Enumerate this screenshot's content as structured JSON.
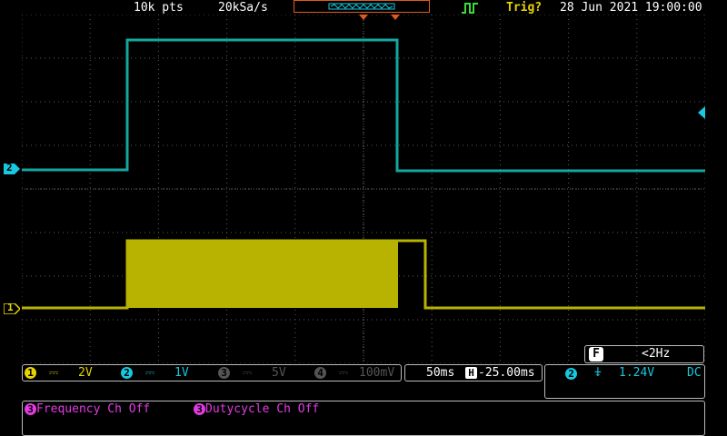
{
  "header": {
    "record_length": "10k pts",
    "sample_rate": "20kSa/s",
    "trigger_status": "Trig?",
    "datetime": "28 Jun 2021 19:00:00"
  },
  "channel_markers": {
    "ch1": "1",
    "ch2": "2"
  },
  "channels": [
    {
      "num": "1",
      "coupling_icon": "dc-coupling-icon",
      "scale": "2V",
      "color": "#e8d400"
    },
    {
      "num": "2",
      "coupling_icon": "dc-coupling-icon",
      "scale": "1V",
      "color": "#16c9e0"
    },
    {
      "num": "3",
      "coupling_icon": "dc-coupling-icon",
      "scale": "5V",
      "color": "#555555"
    },
    {
      "num": "4",
      "coupling_icon": "dc-coupling-icon",
      "scale": "100mV",
      "color": "#555555"
    }
  ],
  "timebase": {
    "scale": "50ms",
    "h_label": "H",
    "position": "-25.00ms"
  },
  "frequency_counter": {
    "label": "F",
    "value": "<2Hz"
  },
  "trigger": {
    "source": "2",
    "slope_icon": "falling-edge-icon",
    "level": "1.24V",
    "coupling": "DC"
  },
  "measurements": [
    {
      "channel": "3",
      "text": "Frequency Ch Off"
    },
    {
      "channel": "3",
      "text": "Dutycycle Ch Off"
    }
  ],
  "colors": {
    "ch1": "#b8b300",
    "ch1_label": "#e8d400",
    "ch2": "#12a8a0",
    "ch2_label": "#16c9e0",
    "measure": "#e23be2",
    "trigger_marker": "#e05a1e",
    "grid": "#5a5a5a"
  }
}
